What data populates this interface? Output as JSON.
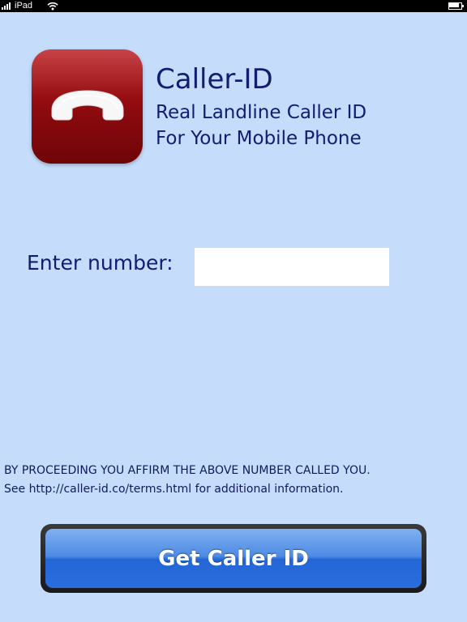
{
  "status_bar": {
    "carrier": "iPad",
    "signal_icon": "signal-bars-icon",
    "wifi_icon": "wifi-icon",
    "battery_icon": "battery-icon",
    "battery_level": 0.9
  },
  "app": {
    "icon": "phone-handset-icon",
    "icon_color": "#9a0f13",
    "title": "Caller-ID",
    "subtitle_line1": "Real Landline Caller ID",
    "subtitle_line2": "For Your Mobile Phone"
  },
  "form": {
    "label": "Enter number:",
    "number_value": "",
    "number_placeholder": ""
  },
  "disclaimer": {
    "line1": "BY PROCEEDING YOU AFFIRM THE ABOVE NUMBER CALLED YOU.",
    "line2": "See http://caller-id.co/terms.html for additional information."
  },
  "action": {
    "button_label": "Get Caller ID",
    "button_color": "#2f72dc"
  },
  "colors": {
    "background": "#c5dcfb",
    "text": "#121c70"
  }
}
